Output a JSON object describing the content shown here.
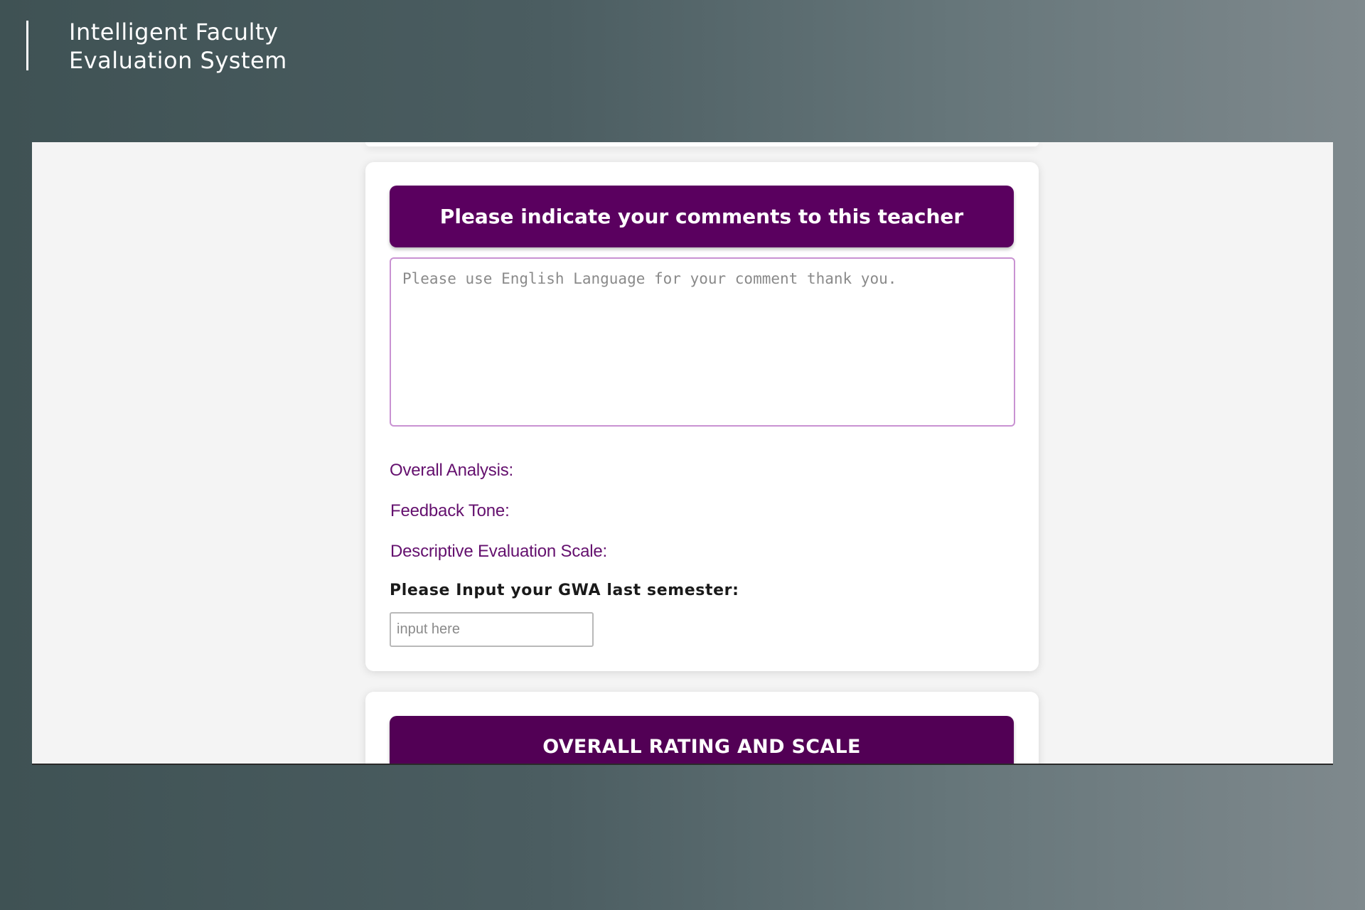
{
  "brand": {
    "line1": "Intelligent Faculty",
    "line2": "Evaluation System"
  },
  "comments_section": {
    "header": "Please indicate your comments to this teacher",
    "comment_placeholder": "Please use English Language for your comment thank you.",
    "overall_analysis_label": "Overall Analysis:",
    "feedback_tone_label": "Feedback Tone:",
    "descriptive_scale_label": "Descriptive Evaluation Scale:",
    "gwa_label": "Please Input your GWA last semester:",
    "gwa_placeholder": "input here"
  },
  "rating_section": {
    "header": "OVERALL RATING AND SCALE"
  },
  "colors": {
    "header_purple": "#5a005f",
    "label_purple": "#64106e",
    "textarea_border": "#c992d2"
  }
}
